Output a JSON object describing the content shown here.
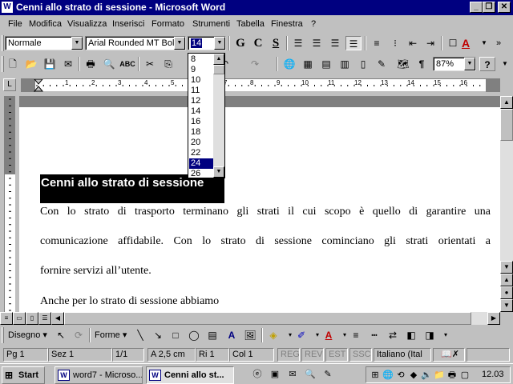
{
  "window": {
    "title": "Cenni allo strato di sessione - Microsoft Word",
    "app_icon": "W"
  },
  "menu": [
    "File",
    "Modifica",
    "Visualizza",
    "Inserisci",
    "Formato",
    "Strumenti",
    "Tabella",
    "Finestra",
    "?"
  ],
  "format_toolbar": {
    "style_value": "Normale",
    "font_value": "Arial Rounded MT Bold",
    "size_value": "14",
    "bold_label": "G",
    "italic_label": "C",
    "underline_label": "S",
    "font_color_label": "A"
  },
  "standard_toolbar": {
    "zoom_value": "87%",
    "pilcrow": "¶",
    "help": "?"
  },
  "size_dropdown": {
    "options": [
      "8",
      "9",
      "10",
      "11",
      "12",
      "14",
      "16",
      "18",
      "20",
      "22",
      "24",
      "26"
    ],
    "selected": "24"
  },
  "ruler": {
    "labels": [
      "1",
      "2",
      "3",
      "4",
      "5",
      "6",
      "7",
      "8",
      "9",
      "10",
      "11",
      "12",
      "13",
      "14",
      "15",
      "16"
    ]
  },
  "document": {
    "heading": "Cenni allo strato di sessione",
    "para1_line1": "Con lo strato di trasporto terminano gli strati il cui scopo è quello di garantire una",
    "para1_line2": "comunicazione affidabile. Con lo strato di sessione cominciano gli strati orientati a",
    "para1_line3": "fornire servizi all’utente.",
    "para2_line1": "Anche per lo strato di sessione abbiamo"
  },
  "draw_toolbar": {
    "draw_label": "Disegno",
    "shapes_label": "Forme"
  },
  "status": {
    "page": "Pg 1",
    "section": "Sez 1",
    "pages": "1/1",
    "position": "A 2,5 cm",
    "line": "Ri 1",
    "column": "Col 1",
    "rec": "REG",
    "rev": "REV",
    "ext": "EST",
    "ovr": "SSC",
    "language": "Italiano (Ital"
  },
  "taskbar": {
    "start_label": "Start",
    "task1": "word7 - Microso...",
    "task2": "Cenni allo st...",
    "clock": "12.03"
  }
}
